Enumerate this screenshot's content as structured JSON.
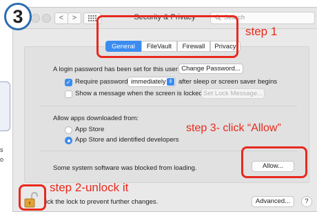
{
  "tutorial": {
    "step_number": "3",
    "side_glyphs": [
      "s",
      "o"
    ]
  },
  "window": {
    "title": "Security & Privacy",
    "search_placeholder": "Search",
    "nav_back": "<",
    "nav_forward": ">",
    "grid_icon": "grid-icon"
  },
  "tabs": [
    {
      "label": "General",
      "active": true
    },
    {
      "label": "FileVault",
      "active": false
    },
    {
      "label": "Firewall",
      "active": false
    },
    {
      "label": "Privacy",
      "active": false
    }
  ],
  "login": {
    "text": "A login password has been set for this user",
    "change_button": "Change Password..."
  },
  "require_password": {
    "checked": true,
    "label": "Require password",
    "select_value": "immediately",
    "after_text": "after sleep or screen saver begins"
  },
  "show_message": {
    "checked": false,
    "label": "Show a message when the screen is locked",
    "button": "Set Lock Message..."
  },
  "allow_apps": {
    "heading": "Allow apps downloaded from:",
    "options": [
      {
        "label": "App Store",
        "selected": false
      },
      {
        "label": "App Store and identified developers",
        "selected": true
      }
    ]
  },
  "blocked": {
    "text": "Some system software was blocked from loading.",
    "allow_button": "Allow..."
  },
  "footer": {
    "lock_text": "lick the lock to prevent further changes.",
    "advanced_button": "Advanced...",
    "help_button": "?"
  },
  "annotations": {
    "step1": "step 1",
    "step2": "step 2-unlock it",
    "step3": "step 3- click “Allow”",
    "color": "#e8291c"
  }
}
